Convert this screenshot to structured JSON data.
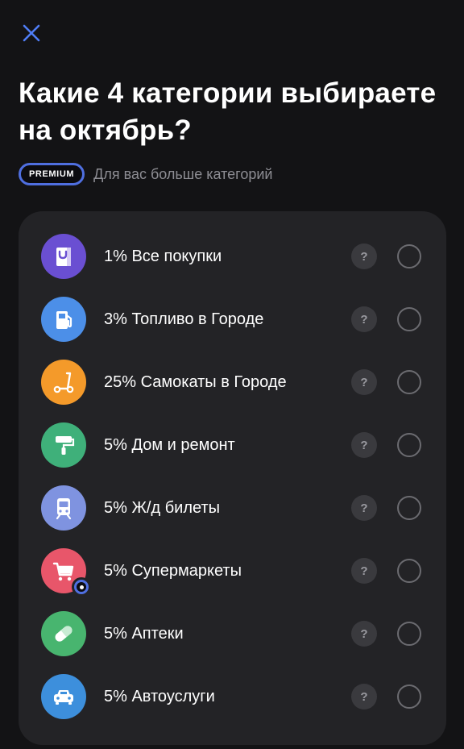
{
  "header": {
    "title": "Какие 4 категории выбираете на октябрь?",
    "premium_badge": "PREMIUM",
    "premium_text": "Для вас больше категорий"
  },
  "colors": {
    "background": "#131315",
    "card": "#232326",
    "accent": "#4f6fe0",
    "close_icon": "#4f7df5"
  },
  "categories": [
    {
      "label": "1% Все покупки",
      "icon": "shopping-bag-icon",
      "color": "#6a4fd2",
      "selected": false
    },
    {
      "label": "3% Топливо в Городе",
      "icon": "fuel-pump-icon",
      "color": "#4c8fe8",
      "selected": false
    },
    {
      "label": "25% Самокаты в Городе",
      "icon": "scooter-icon",
      "color": "#f49a2a",
      "selected": false
    },
    {
      "label": "5% Дом и ремонт",
      "icon": "paint-roller-icon",
      "color": "#3fb07a",
      "selected": false
    },
    {
      "label": "5% Ж/д билеты",
      "icon": "train-icon",
      "color": "#7f93e0",
      "selected": false
    },
    {
      "label": "5% Супермаркеты",
      "icon": "shopping-cart-icon",
      "color": "#e8566a",
      "selected": false,
      "premium": true
    },
    {
      "label": "5% Аптеки",
      "icon": "pill-icon",
      "color": "#48b56f",
      "selected": false
    },
    {
      "label": "5% Автоуслуги",
      "icon": "car-icon",
      "color": "#3d8fdc",
      "selected": false
    }
  ],
  "help_label": "?"
}
